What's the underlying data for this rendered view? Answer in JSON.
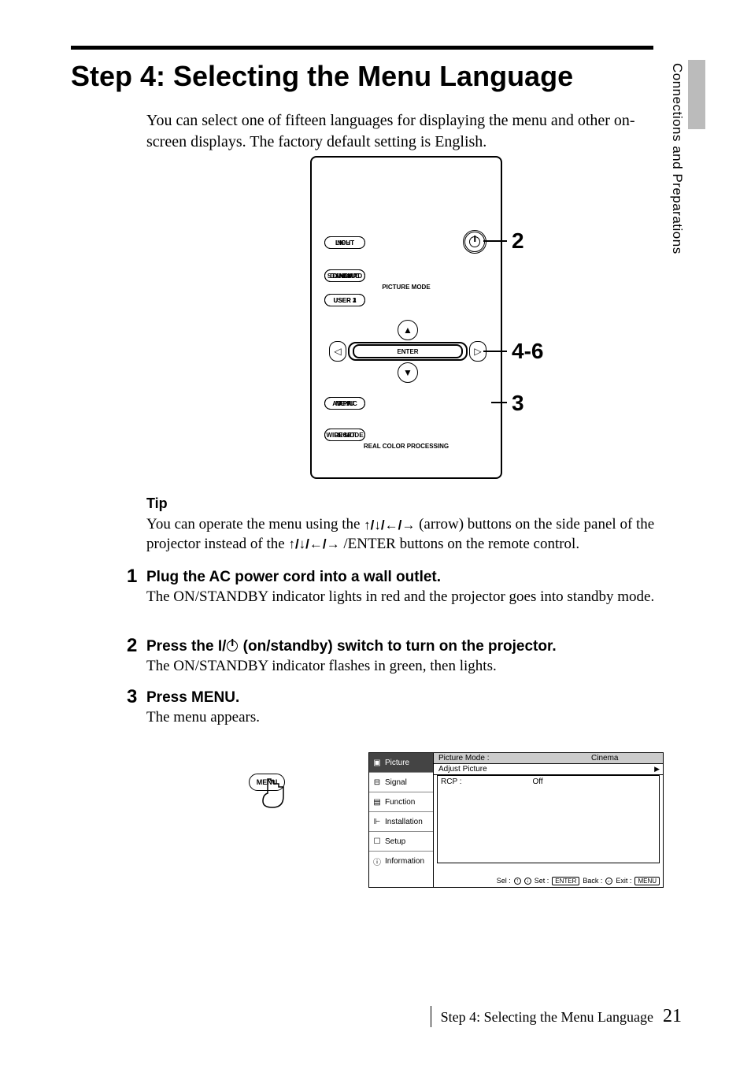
{
  "sideTab": "Connections and Preparations",
  "h1": "Step 4: Selecting the Menu Language",
  "intro": "You can select one of fifteen languages for displaying the menu and other on-screen displays. The factory default setting is English.",
  "remote": {
    "light": "LIGHT",
    "input": "INPUT",
    "dynamic": "DYNAMIC",
    "standard": "STANDARD",
    "cinema": "CINEMA",
    "picMode": "PICTURE MODE",
    "user1": "USER 1",
    "user2": "USER 2",
    "user3": "USER 3",
    "enter": "ENTER",
    "apa": "APA",
    "adjPic": "ADJ PIC",
    "menu": "MENU",
    "wideMode": "WIDE MODE",
    "rcp": "RCP",
    "reset": "RESET",
    "rcpCap": "REAL COLOR PROCESSING"
  },
  "callouts": {
    "a": "2",
    "b": "4-6",
    "c": "3"
  },
  "tip": {
    "heading": "Tip",
    "pre": "You can operate the menu using the ",
    "mid": " (arrow) buttons on the side panel of the projector instead of the ",
    "post": "/ENTER buttons on the remote control."
  },
  "steps": {
    "s1": {
      "n": "1",
      "title": "Plug the AC power cord into a wall outlet.",
      "body": "The ON/STANDBY indicator lights in red and the projector goes into standby mode."
    },
    "s2": {
      "n": "2",
      "titlePre": "Press the ",
      "titleI": "I",
      "titleSlash": "/",
      "titlePost": " (on/standby) switch to turn on the projector.",
      "body": "The ON/STANDBY indicator flashes in green, then lights."
    },
    "s3": {
      "n": "3",
      "title": "Press MENU.",
      "body": "The menu appears."
    }
  },
  "handLabel": "MENU",
  "osd": {
    "tabs": [
      "Picture",
      "Signal",
      "Function",
      "Installation",
      "Setup",
      "Information"
    ],
    "hdr1Label": "Picture Mode :",
    "hdr1Val": "Cinema",
    "row2": "Adjust Picture",
    "rcpLabel": "RCP :",
    "rcpVal": "Off",
    "foot": {
      "sel": "Sel :",
      "set": "Set :",
      "back": "Back :",
      "exit": "Exit :",
      "enter": "ENTER",
      "menu": "MENU"
    }
  },
  "footer": {
    "label": "Step 4: Selecting the Menu Language",
    "page": "21"
  }
}
